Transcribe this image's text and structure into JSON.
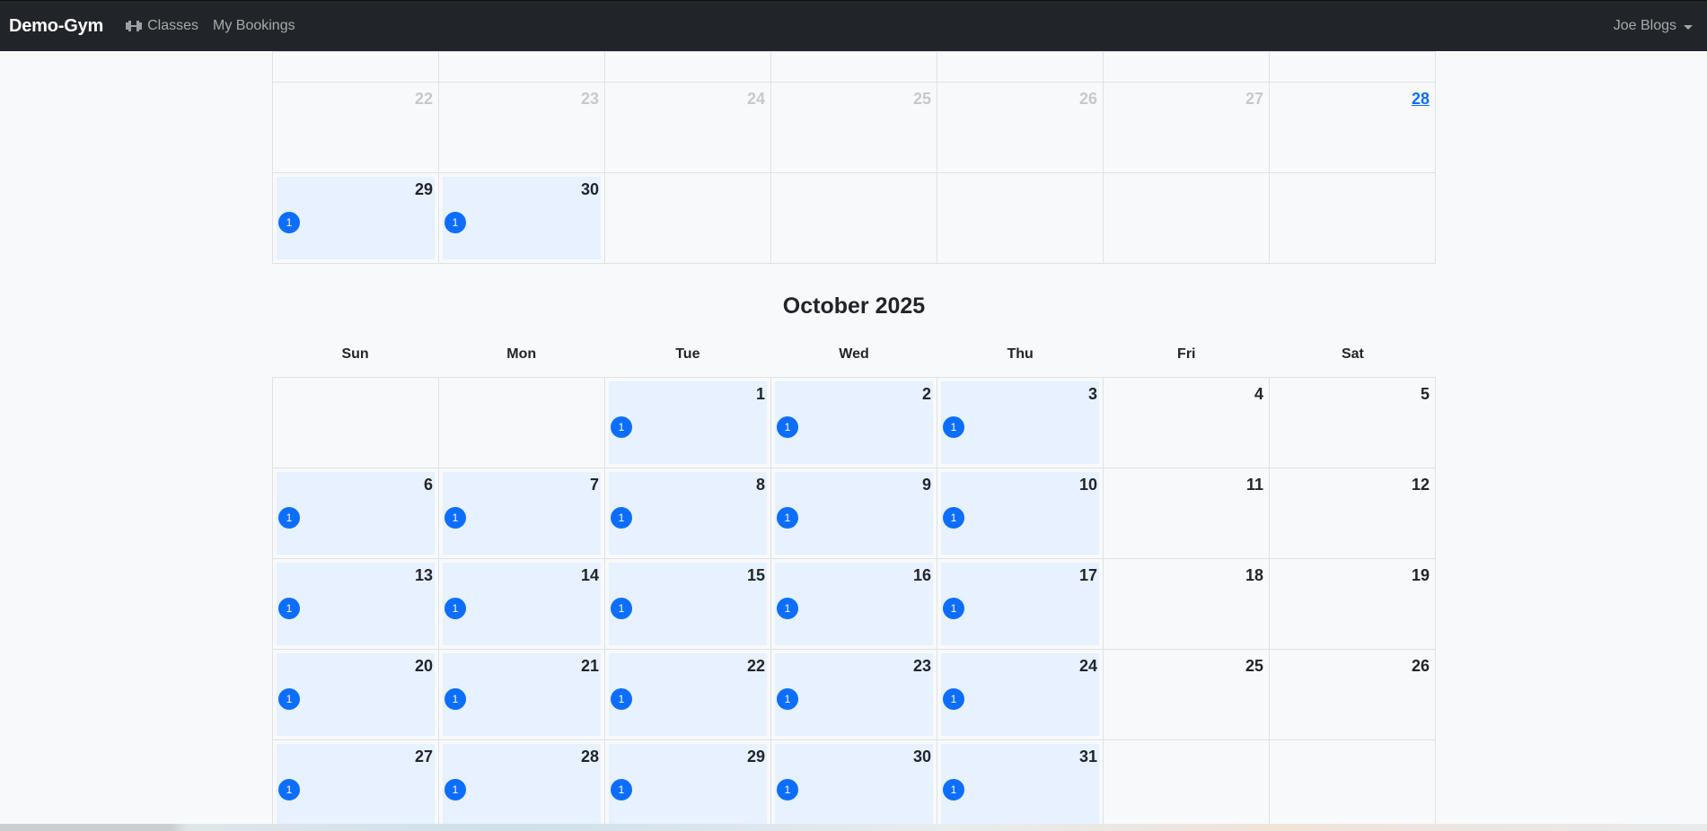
{
  "navbar": {
    "brand": "Demo-Gym",
    "classes_label": "Classes",
    "bookings_label": "My Bookings",
    "user_label": "Joe Blogs",
    "icons": {
      "classes": "dumbbell-icon",
      "user_menu": "caret-down-icon"
    }
  },
  "colors": {
    "navbar_bg": "#212529",
    "event_bg": "#e7f1ff",
    "badge": "#0d6efd",
    "today": "#0d6efd",
    "muted": "#c6c9cc"
  },
  "september_partial": {
    "rows": [
      [
        {
          "n": "",
          "muted": false
        },
        {
          "n": "",
          "muted": false
        },
        {
          "n": "",
          "muted": false
        },
        {
          "n": "",
          "muted": false
        },
        {
          "n": "",
          "muted": false
        },
        {
          "n": "",
          "muted": false
        },
        {
          "n": "",
          "muted": false
        }
      ],
      [
        {
          "n": "22",
          "muted": true
        },
        {
          "n": "23",
          "muted": true
        },
        {
          "n": "24",
          "muted": true
        },
        {
          "n": "25",
          "muted": true
        },
        {
          "n": "26",
          "muted": true
        },
        {
          "n": "27",
          "muted": true
        },
        {
          "n": "28",
          "today": true
        }
      ],
      [
        {
          "n": "29",
          "event": "1"
        },
        {
          "n": "30",
          "event": "1"
        },
        {
          "n": ""
        },
        {
          "n": ""
        },
        {
          "n": ""
        },
        {
          "n": ""
        },
        {
          "n": ""
        }
      ]
    ]
  },
  "october": {
    "title": "October 2025",
    "weekdays": [
      "Sun",
      "Mon",
      "Tue",
      "Wed",
      "Thu",
      "Fri",
      "Sat"
    ],
    "rows": [
      [
        {
          "n": ""
        },
        {
          "n": ""
        },
        {
          "n": "1",
          "event": "1"
        },
        {
          "n": "2",
          "event": "1"
        },
        {
          "n": "3",
          "event": "1"
        },
        {
          "n": "4"
        },
        {
          "n": "5"
        }
      ],
      [
        {
          "n": "6",
          "event": "1"
        },
        {
          "n": "7",
          "event": "1"
        },
        {
          "n": "8",
          "event": "1"
        },
        {
          "n": "9",
          "event": "1"
        },
        {
          "n": "10",
          "event": "1"
        },
        {
          "n": "11"
        },
        {
          "n": "12"
        }
      ],
      [
        {
          "n": "13",
          "event": "1"
        },
        {
          "n": "14",
          "event": "1"
        },
        {
          "n": "15",
          "event": "1"
        },
        {
          "n": "16",
          "event": "1"
        },
        {
          "n": "17",
          "event": "1"
        },
        {
          "n": "18"
        },
        {
          "n": "19"
        }
      ],
      [
        {
          "n": "20",
          "event": "1"
        },
        {
          "n": "21",
          "event": "1"
        },
        {
          "n": "22",
          "event": "1"
        },
        {
          "n": "23",
          "event": "1"
        },
        {
          "n": "24",
          "event": "1"
        },
        {
          "n": "25"
        },
        {
          "n": "26"
        }
      ],
      [
        {
          "n": "27",
          "event": "1"
        },
        {
          "n": "28",
          "event": "1"
        },
        {
          "n": "29",
          "event": "1"
        },
        {
          "n": "30",
          "event": "1"
        },
        {
          "n": "31",
          "event": "1"
        },
        {
          "n": ""
        },
        {
          "n": ""
        }
      ]
    ]
  }
}
